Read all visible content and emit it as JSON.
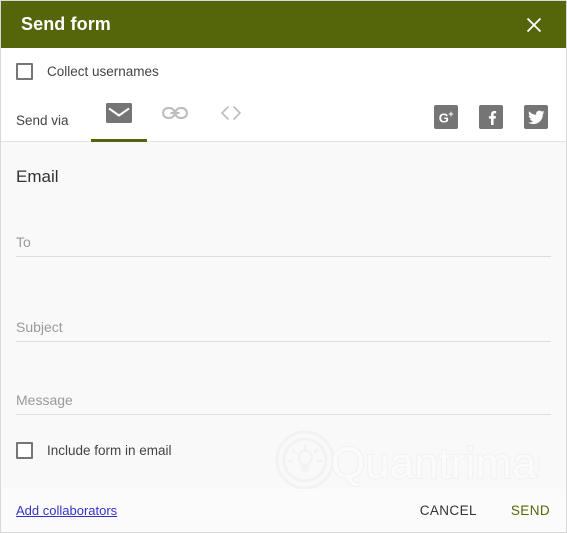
{
  "dialog": {
    "title": "Send form",
    "close_icon": "close-icon",
    "header_color": "#55660a"
  },
  "collect": {
    "label": "Collect usernames",
    "checked": false
  },
  "send_via": {
    "label": "Send via",
    "tabs": [
      {
        "name": "email",
        "icon": "envelope-icon",
        "active": true
      },
      {
        "name": "link",
        "icon": "link-icon",
        "active": false
      },
      {
        "name": "embed",
        "icon": "embed-code-icon",
        "active": false
      }
    ],
    "socials": [
      {
        "name": "google-plus",
        "icon": "google-plus-icon",
        "glyph": "G",
        "sup": "+"
      },
      {
        "name": "facebook",
        "icon": "facebook-icon",
        "glyph": "f"
      },
      {
        "name": "twitter",
        "icon": "twitter-icon",
        "glyph": "bird"
      }
    ]
  },
  "email_form": {
    "heading": "Email",
    "to": {
      "placeholder": "To",
      "value": ""
    },
    "subject": {
      "placeholder": "Subject",
      "value": ""
    },
    "message": {
      "placeholder": "Message",
      "value": ""
    },
    "include_form": {
      "label": "Include form in email",
      "checked": false
    }
  },
  "watermark": {
    "text": "Quantrimang",
    "icon": "lightbulb-logo-icon"
  },
  "footer": {
    "add_collaborators": "Add collaborators",
    "cancel": "CANCEL",
    "send": "SEND",
    "send_color": "#55660a",
    "link_color": "#3333cc"
  }
}
